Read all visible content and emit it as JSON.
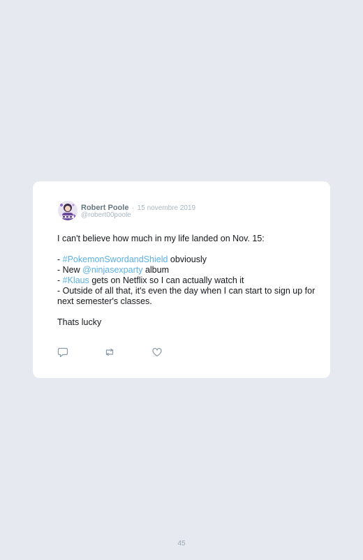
{
  "tweet": {
    "author_name": "Robert Poole",
    "separator": "·",
    "date": "15 novembre 2019",
    "handle": "@robert00poole",
    "intro": "I can't believe how much in my life landed on Nov. 15:",
    "line1_prefix": "- ",
    "line1_hashtag": "#PokemonSwordandShield",
    "line1_suffix": " obviously",
    "line2_prefix": "- New ",
    "line2_mention": "@ninjasexparty",
    "line2_suffix": " album",
    "line3_prefix": "- ",
    "line3_hashtag": "#Klaus",
    "line3_suffix": " gets on Netflix so I can actually watch it",
    "line4": "- Outside of all that, it's even the day when I can start to sign up for next semester's classes.",
    "closing": "Thats lucky"
  },
  "actions": {
    "reply_icon": "speech-bubble",
    "retweet_icon": "retweet-arrows",
    "like_icon": "heart-outline"
  },
  "colors": {
    "background": "#e6eaf0",
    "card": "#ffffff",
    "link": "#5ab0e6",
    "text": "#14171a",
    "muted": "#aab8c2"
  },
  "page": {
    "number": "45"
  }
}
